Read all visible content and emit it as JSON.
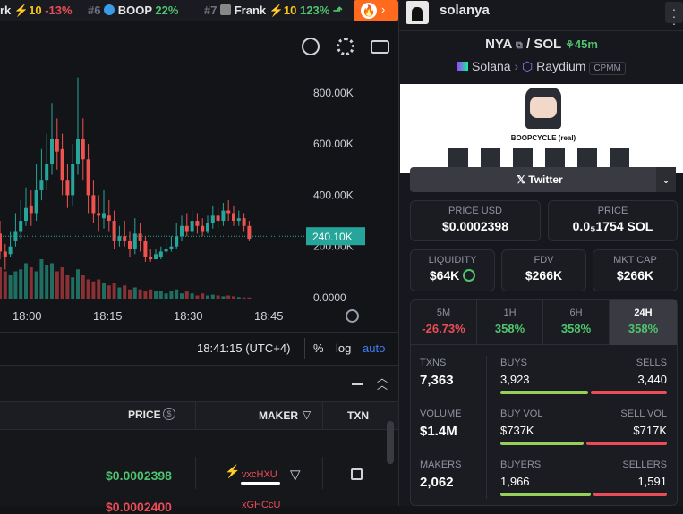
{
  "ticker": [
    {
      "name": "rk",
      "boost": "⚡10",
      "change": "-13%"
    },
    {
      "rank": "#6",
      "name": "BOOP",
      "change": "22%"
    },
    {
      "rank": "#7",
      "name": "Frank",
      "boost": "⚡10",
      "change": "123%"
    }
  ],
  "chart": {
    "y_ticks": [
      "800.00K",
      "600.00K",
      "400.00K",
      "200.00K",
      "0.0000"
    ],
    "x_ticks": [
      "18:00",
      "18:15",
      "18:30",
      "18:45"
    ],
    "current_price": "240.10K",
    "clock": "18:41:15 (UTC+4)",
    "scale_percent": "%",
    "scale_log": "log",
    "scale_auto": "auto",
    "candles": [
      [
        250,
        180,
        300,
        150
      ],
      [
        180,
        160,
        210,
        110
      ],
      [
        170,
        200,
        260,
        160
      ],
      [
        220,
        260,
        330,
        200
      ],
      [
        260,
        300,
        380,
        230
      ],
      [
        300,
        350,
        430,
        280
      ],
      [
        360,
        330,
        420,
        280
      ],
      [
        330,
        420,
        520,
        300
      ],
      [
        420,
        460,
        580,
        380
      ],
      [
        460,
        520,
        640,
        420
      ],
      [
        520,
        620,
        760,
        480
      ],
      [
        620,
        570,
        700,
        500
      ],
      [
        580,
        460,
        640,
        400
      ],
      [
        460,
        400,
        520,
        350
      ],
      [
        400,
        520,
        600,
        360
      ],
      [
        520,
        620,
        860,
        480
      ],
      [
        620,
        540,
        700,
        460
      ],
      [
        540,
        400,
        600,
        330
      ],
      [
        400,
        330,
        460,
        290
      ],
      [
        330,
        320,
        400,
        260
      ],
      [
        310,
        330,
        420,
        270
      ],
      [
        320,
        300,
        380,
        260
      ],
      [
        300,
        220,
        340,
        190
      ],
      [
        220,
        240,
        280,
        200
      ],
      [
        240,
        220,
        300,
        200
      ],
      [
        220,
        190,
        260,
        160
      ],
      [
        190,
        250,
        310,
        170
      ],
      [
        250,
        220,
        290,
        180
      ],
      [
        220,
        160,
        240,
        140
      ],
      [
        160,
        150,
        190,
        140
      ],
      [
        150,
        170,
        190,
        150
      ],
      [
        160,
        180,
        200,
        150
      ],
      [
        180,
        190,
        230,
        170
      ],
      [
        190,
        200,
        240,
        180
      ],
      [
        200,
        240,
        290,
        190
      ],
      [
        240,
        280,
        320,
        220
      ],
      [
        280,
        260,
        330,
        240
      ],
      [
        260,
        300,
        340,
        240
      ],
      [
        300,
        280,
        330,
        250
      ],
      [
        280,
        260,
        310,
        240
      ],
      [
        260,
        290,
        320,
        250
      ],
      [
        290,
        320,
        360,
        270
      ],
      [
        320,
        300,
        350,
        270
      ],
      [
        300,
        340,
        370,
        280
      ],
      [
        340,
        330,
        380,
        300
      ],
      [
        330,
        300,
        360,
        280
      ],
      [
        300,
        310,
        340,
        280
      ],
      [
        310,
        280,
        330,
        260
      ],
      [
        280,
        230,
        300,
        220
      ]
    ],
    "volumes": [
      0.8,
      0.7,
      0.6,
      0.7,
      0.75,
      0.9,
      0.8,
      0.7,
      1.0,
      0.85,
      0.9,
      0.7,
      0.8,
      0.6,
      0.55,
      0.75,
      0.6,
      0.5,
      0.45,
      0.5,
      0.4,
      0.35,
      0.4,
      0.3,
      0.35,
      0.25,
      0.3,
      0.25,
      0.2,
      0.25,
      0.2,
      0.2,
      0.15,
      0.2,
      0.25,
      0.15,
      0.2,
      0.15,
      0.1,
      0.15,
      0.1,
      0.12,
      0.1,
      0.08,
      0.1,
      0.08,
      0.06,
      0.05,
      0.05
    ]
  },
  "table": {
    "headers": {
      "price": "PRICE",
      "maker": "MAKER",
      "txn": "TXN"
    },
    "rows": [
      {
        "price": "$0.0002398",
        "maker": "vxcHXU"
      },
      {
        "price": "$0.0002400",
        "maker": "xGHCcU"
      }
    ]
  },
  "right": {
    "username": "solanya",
    "pair": {
      "base": "NYA",
      "quote": "SOL",
      "age": "45m",
      "chain": "Solana",
      "dex": "Raydium",
      "pool": "CPMM"
    },
    "banner": "BOOPCYCLE (real)",
    "twitter": "Twitter",
    "price_usd": {
      "label": "PRICE USD",
      "value": "$0.0002398"
    },
    "price_sol": {
      "label": "PRICE",
      "value": "0.0₅1754 SOL"
    },
    "liquidity": {
      "label": "LIQUIDITY",
      "value": "$64K"
    },
    "fdv": {
      "label": "FDV",
      "value": "$266K"
    },
    "mcap": {
      "label": "MKT CAP",
      "value": "$266K"
    },
    "tabs": [
      {
        "label": "5M",
        "value": "-26.73%"
      },
      {
        "label": "1H",
        "value": "358%"
      },
      {
        "label": "6H",
        "value": "358%"
      },
      {
        "label": "24H",
        "value": "358%"
      }
    ],
    "stats": {
      "txns": {
        "label": "TXNS",
        "value": "7,363"
      },
      "buys": {
        "label": "BUYS",
        "value": "3,923"
      },
      "sells": {
        "label": "SELLS",
        "value": "3,440"
      },
      "volume": {
        "label": "VOLUME",
        "value": "$1.4M"
      },
      "buyvol": {
        "label": "BUY VOL",
        "value": "$737K"
      },
      "sellvol": {
        "label": "SELL VOL",
        "value": "$717K"
      },
      "makers": {
        "label": "MAKERS",
        "value": "2,062"
      },
      "buyers": {
        "label": "BUYERS",
        "value": "1,966"
      },
      "sellers": {
        "label": "SELLERS",
        "value": "1,591"
      }
    }
  },
  "colors": {
    "up": "#26a69a",
    "down": "#ef5350",
    "accent": "#4fc46f"
  }
}
